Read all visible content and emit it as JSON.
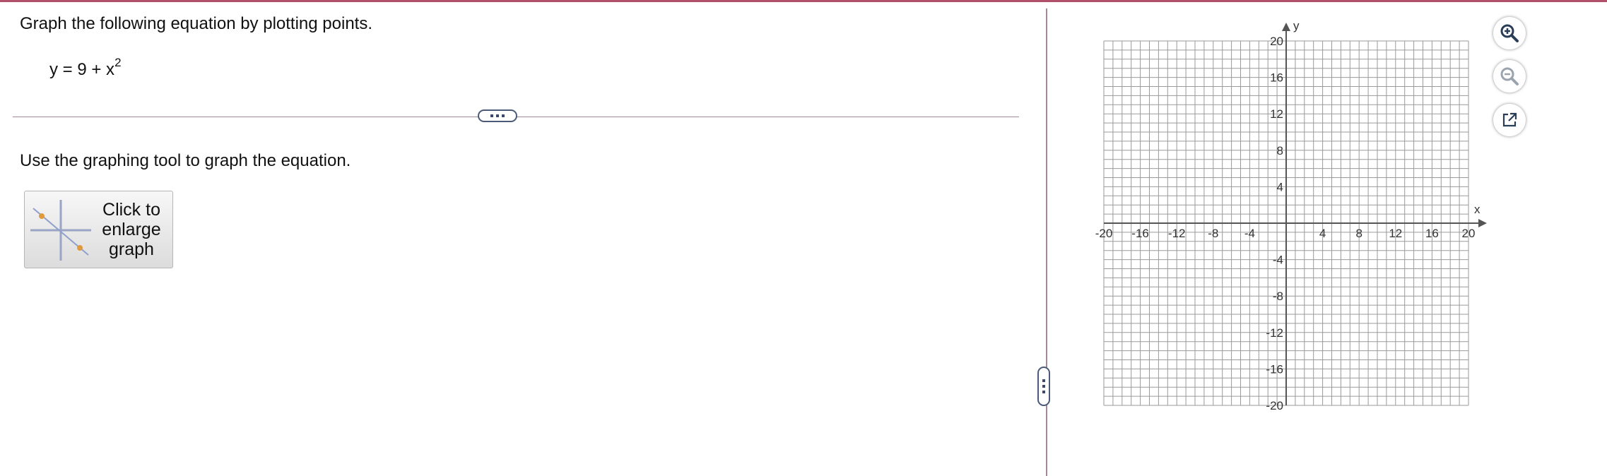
{
  "question": {
    "prompt": "Graph the following equation by plotting points.",
    "equation_base": "y = 9 + x",
    "equation_exponent": "2"
  },
  "instruction": "Use the graphing tool to graph the equation.",
  "enlarge_button": {
    "label": "Click to enlarge graph"
  },
  "graph": {
    "x_axis_label": "x",
    "y_axis_label": "y",
    "x_range": [
      -20,
      20
    ],
    "y_range": [
      -20,
      20
    ],
    "grid_step": 1,
    "x_tick_labels": [
      "-20",
      "-16",
      "-12",
      "-8",
      "-4",
      "4",
      "8",
      "12",
      "16",
      "20"
    ],
    "y_tick_labels": [
      "20",
      "16",
      "12",
      "8",
      "4",
      "-4",
      "-8",
      "-12",
      "-16",
      "-20"
    ]
  },
  "tools": [
    "zoom-in-icon",
    "zoom-out-icon",
    "open-in-new-window-icon"
  ],
  "colors": {
    "accent_rule": "#b0506a",
    "tool_icon": "#2a3d57"
  }
}
